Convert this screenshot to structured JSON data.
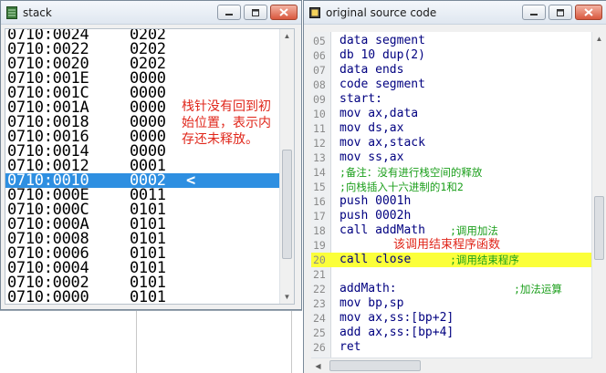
{
  "stack_window": {
    "title": "stack",
    "icon": "stack-window-icon",
    "rows": [
      {
        "addr": "0710:0024",
        "val": "0202",
        "mark": ""
      },
      {
        "addr": "0710:0022",
        "val": "0202",
        "mark": ""
      },
      {
        "addr": "0710:0020",
        "val": "0202",
        "mark": ""
      },
      {
        "addr": "0710:001E",
        "val": "0000",
        "mark": ""
      },
      {
        "addr": "0710:001C",
        "val": "0000",
        "mark": ""
      },
      {
        "addr": "0710:001A",
        "val": "0000",
        "mark": ""
      },
      {
        "addr": "0710:0018",
        "val": "0000",
        "mark": ""
      },
      {
        "addr": "0710:0016",
        "val": "0000",
        "mark": ""
      },
      {
        "addr": "0710:0014",
        "val": "0000",
        "mark": ""
      },
      {
        "addr": "0710:0012",
        "val": "0001",
        "mark": ""
      },
      {
        "addr": "0710:0010",
        "val": "0002",
        "mark": "<"
      },
      {
        "addr": "0710:000E",
        "val": "0011",
        "mark": ""
      },
      {
        "addr": "0710:000C",
        "val": "0101",
        "mark": ""
      },
      {
        "addr": "0710:000A",
        "val": "0101",
        "mark": ""
      },
      {
        "addr": "0710:0008",
        "val": "0101",
        "mark": ""
      },
      {
        "addr": "0710:0006",
        "val": "0101",
        "mark": ""
      },
      {
        "addr": "0710:0004",
        "val": "0101",
        "mark": ""
      },
      {
        "addr": "0710:0002",
        "val": "0101",
        "mark": ""
      },
      {
        "addr": "0710:0000",
        "val": "0101",
        "mark": ""
      }
    ],
    "selected_index": 10,
    "note": "栈针没有回到初始位置，表示内存还未释放。"
  },
  "source_window": {
    "title": "original source code",
    "icon": "source-window-icon",
    "lines": [
      {
        "n": "05",
        "code": "data segment",
        "comment": ""
      },
      {
        "n": "06",
        "code": "db 10 dup(2)",
        "comment": ""
      },
      {
        "n": "07",
        "code": "data ends",
        "comment": ""
      },
      {
        "n": "08",
        "code": "code segment",
        "comment": ""
      },
      {
        "n": "09",
        "code": "start:",
        "comment": ""
      },
      {
        "n": "10",
        "code": "mov ax,data",
        "comment": ""
      },
      {
        "n": "11",
        "code": "mov ds,ax",
        "comment": ""
      },
      {
        "n": "12",
        "code": "mov ax,stack",
        "comment": ""
      },
      {
        "n": "13",
        "code": "mov ss,ax",
        "comment": ""
      },
      {
        "n": "14",
        "code": "",
        "comment": ";备注：没有进行栈空间的释放"
      },
      {
        "n": "15",
        "code": "",
        "comment": ";向栈插入十六进制的1和2"
      },
      {
        "n": "16",
        "code": "push 0001h",
        "comment": ""
      },
      {
        "n": "17",
        "code": "push 0002h",
        "comment": ""
      },
      {
        "n": "18",
        "code": "call addMath",
        "comment": ";调用加法"
      },
      {
        "n": "19",
        "code": "",
        "comment": ""
      },
      {
        "n": "20",
        "code": "call close",
        "comment": ";调用结束程序"
      },
      {
        "n": "21",
        "code": "",
        "comment": ""
      },
      {
        "n": "22",
        "code": "addMath:",
        "comment": ";加法运算"
      },
      {
        "n": "23",
        "code": "mov bp,sp",
        "comment": ""
      },
      {
        "n": "24",
        "code": "mov ax,ss:[bp+2]",
        "comment": ""
      },
      {
        "n": "25",
        "code": "add ax,ss:[bp+4]",
        "comment": ""
      },
      {
        "n": "26",
        "code": "ret",
        "comment": ""
      }
    ],
    "highlight_line": "20",
    "note": "该调用结束程序函数"
  },
  "colors": {
    "selection": "#2e8fe1",
    "highlight": "#fbff3a",
    "note": "#e0271b",
    "comment": "#1a9e1a",
    "code": "#000080"
  }
}
